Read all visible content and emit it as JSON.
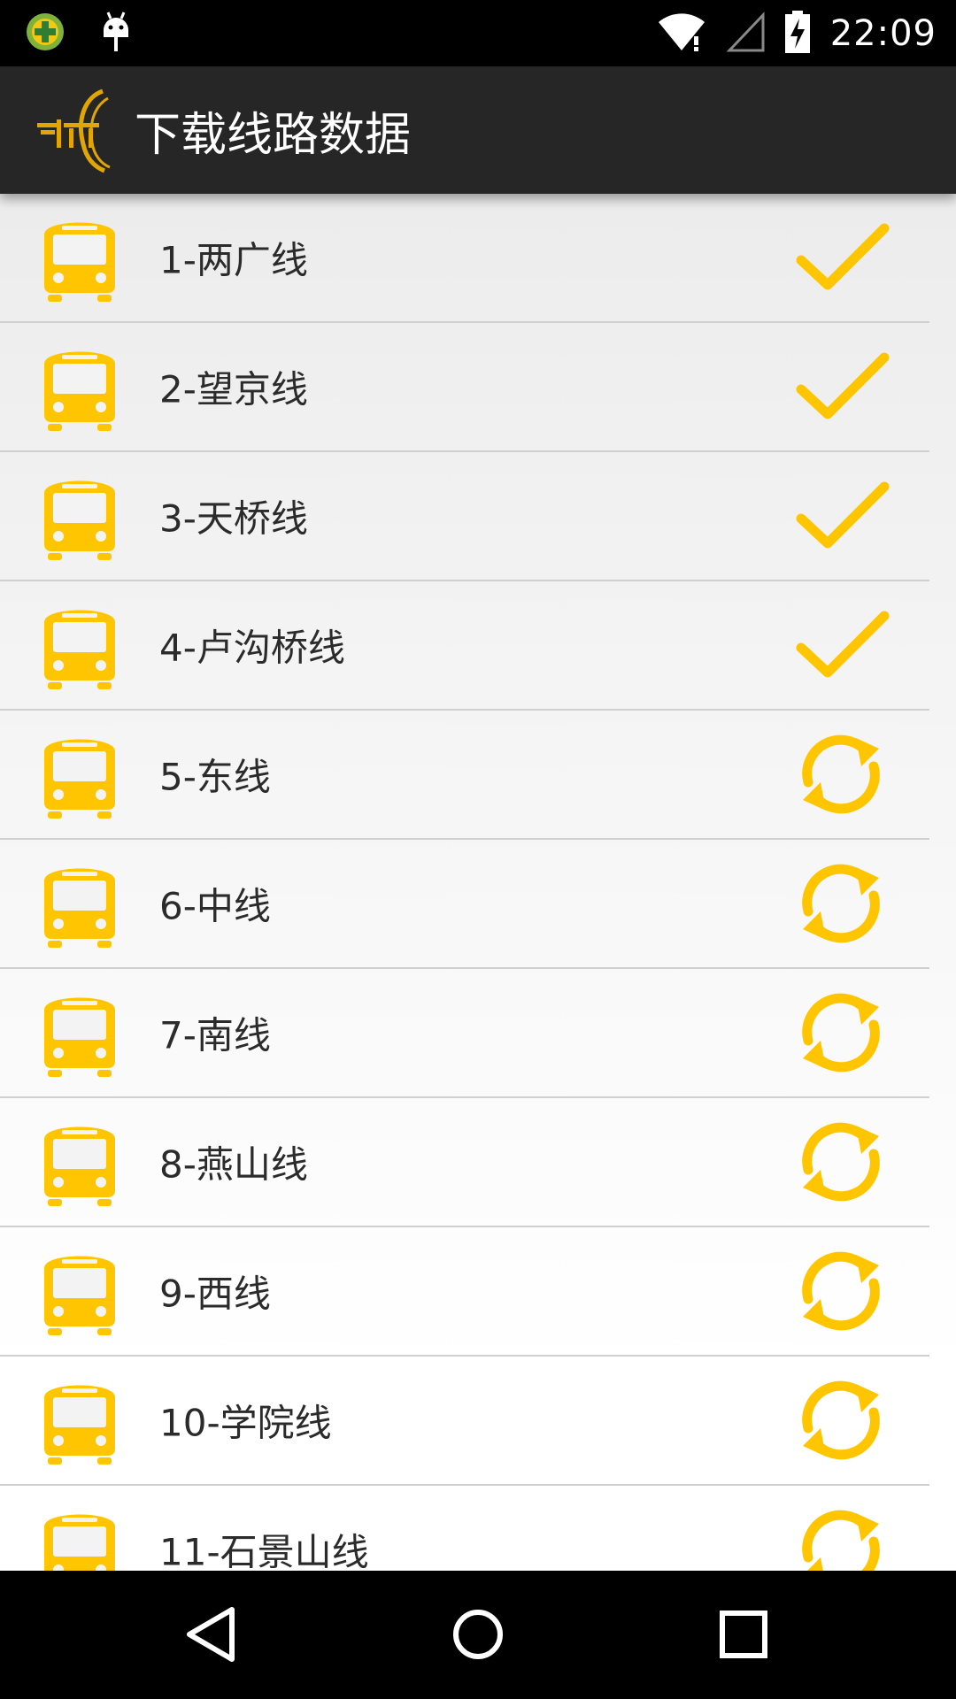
{
  "status_bar": {
    "time": "22:09",
    "icons": [
      "plus-badge-icon",
      "android-debug-icon",
      "wifi-icon",
      "signal-icon",
      "battery-charging-icon"
    ]
  },
  "app_bar": {
    "title": "下载线路数据",
    "logo_icon": "app-logo-icon"
  },
  "colors": {
    "accent": "#FFC600",
    "action_bar": "#262626",
    "text": "#2B2B2B"
  },
  "routes": [
    {
      "label": "1-两广线",
      "status": "downloaded",
      "status_icon": "check-icon"
    },
    {
      "label": "2-望京线",
      "status": "downloaded",
      "status_icon": "check-icon"
    },
    {
      "label": "3-天桥线",
      "status": "downloaded",
      "status_icon": "check-icon"
    },
    {
      "label": "4-卢沟桥线",
      "status": "downloaded",
      "status_icon": "check-icon"
    },
    {
      "label": "5-东线",
      "status": "update",
      "status_icon": "refresh-icon"
    },
    {
      "label": "6-中线",
      "status": "update",
      "status_icon": "refresh-icon"
    },
    {
      "label": "7-南线",
      "status": "update",
      "status_icon": "refresh-icon"
    },
    {
      "label": "8-燕山线",
      "status": "update",
      "status_icon": "refresh-icon"
    },
    {
      "label": "9-西线",
      "status": "update",
      "status_icon": "refresh-icon"
    },
    {
      "label": "10-学院线",
      "status": "update",
      "status_icon": "refresh-icon"
    },
    {
      "label": "11-石景山线",
      "status": "update",
      "status_icon": "refresh-icon"
    }
  ],
  "nav_bar": {
    "icons": [
      "back-icon",
      "home-icon",
      "recents-icon"
    ]
  }
}
